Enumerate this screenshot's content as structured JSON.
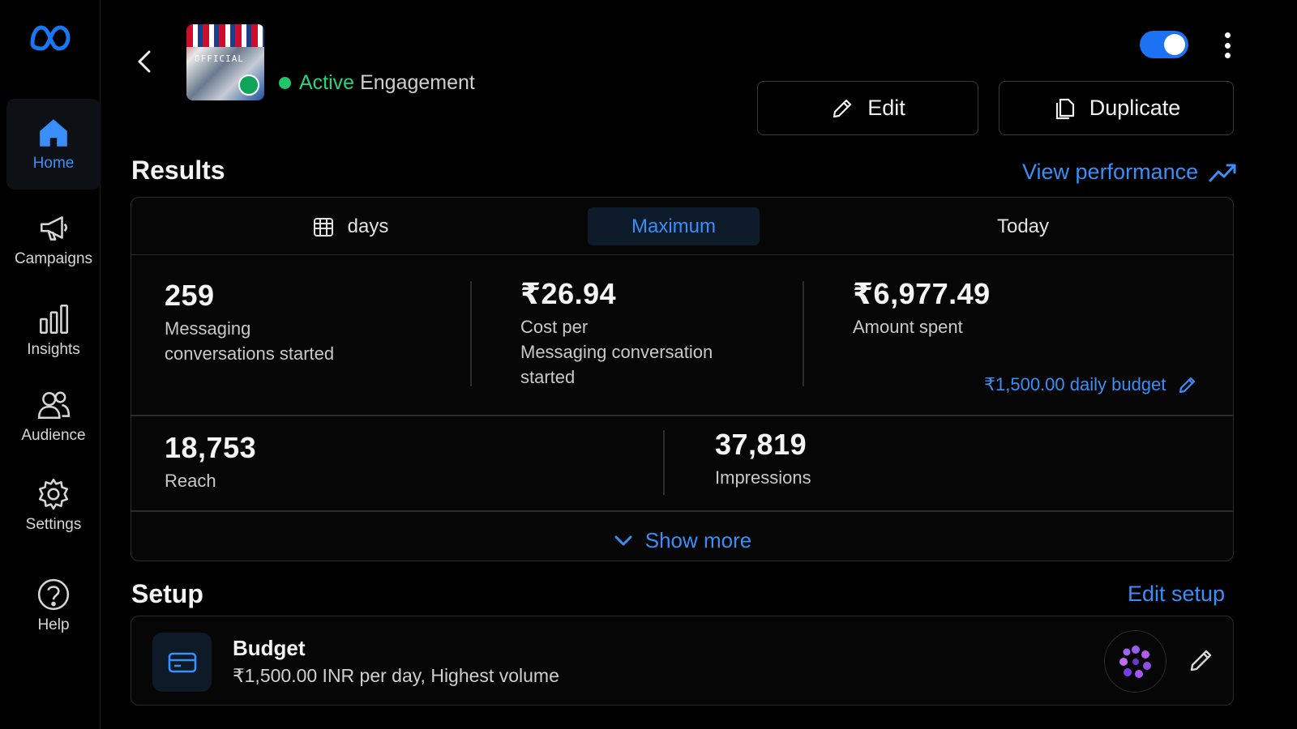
{
  "sidebar": {
    "items": [
      {
        "label": "Home",
        "icon": "home-icon",
        "active": true
      },
      {
        "label": "Campaigns",
        "icon": "megaphone-icon"
      },
      {
        "label": "Insights",
        "icon": "bar-chart-icon"
      },
      {
        "label": "Audience",
        "icon": "people-icon"
      },
      {
        "label": "Settings",
        "icon": "gear-icon"
      },
      {
        "label": "Help",
        "icon": "help-icon"
      }
    ]
  },
  "header": {
    "status_active": "Active",
    "objective": "Engagement",
    "thumbnail_text": "OFFICIAL",
    "toggle_on": true,
    "edit_label": "Edit",
    "duplicate_label": "Duplicate"
  },
  "results": {
    "title": "Results",
    "view_performance": "View performance",
    "tabs": [
      {
        "label": "days",
        "icon": "calendar-icon"
      },
      {
        "label": "Maximum",
        "selected": true
      },
      {
        "label": "Today"
      }
    ],
    "metrics": [
      {
        "value": "259",
        "label_line1": "Messaging",
        "label_line2": "conversations started"
      },
      {
        "value": "₹26.94",
        "label_line1": "Cost per",
        "label_line2": "Messaging conversation",
        "label_line3": "started"
      },
      {
        "value": "₹6,977.49",
        "label_line1": "Amount spent"
      },
      {
        "value": "18,753",
        "label_line1": "Reach"
      },
      {
        "value": "37,819",
        "label_line1": "Impressions"
      }
    ],
    "daily_budget": "₹1,500.00 daily budget",
    "show_more": "Show more"
  },
  "setup": {
    "title": "Setup",
    "edit_setup": "Edit setup",
    "budget_title": "Budget",
    "budget_detail": "₹1,500.00 INR per day, Highest volume"
  },
  "colors": {
    "accent": "#3a8ef7",
    "active_green": "#2ad47a",
    "toggle": "#1c72f2"
  }
}
